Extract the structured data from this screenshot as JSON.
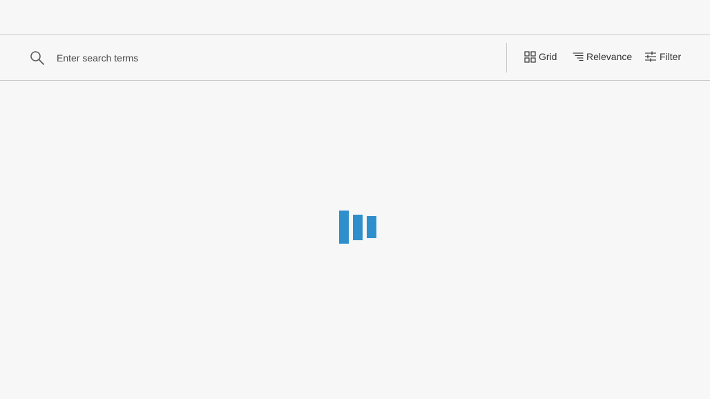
{
  "search": {
    "placeholder": "Enter search terms",
    "value": ""
  },
  "toolbar": {
    "grid_label": "Grid",
    "relevance_label": "Relevance",
    "filter_label": "Filter"
  },
  "icons": {
    "search": "search-icon",
    "grid": "grid-icon",
    "sort": "sort-icon",
    "filter": "filter-sliders-icon"
  },
  "colors": {
    "loader": "#2f8fcc",
    "background": "#f7f7f7",
    "border": "#cacaca",
    "text": "#323232"
  }
}
